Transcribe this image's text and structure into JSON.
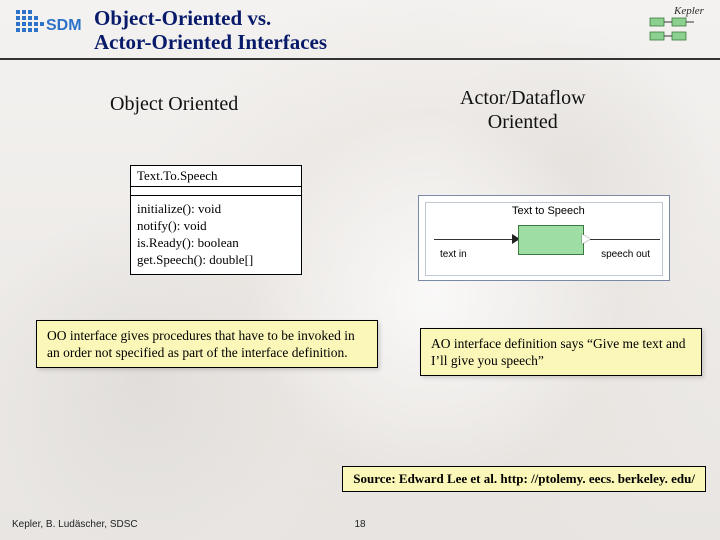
{
  "header": {
    "title_line1": "Object-Oriented vs.",
    "title_line2": "Actor-Oriented Interfaces",
    "logo_left_label": "SDM",
    "logo_right_label": "Kepler"
  },
  "columns": {
    "left_heading": "Object Oriented",
    "right_heading_line1": "Actor/Dataflow",
    "right_heading_line2": "Oriented"
  },
  "uml": {
    "class_name": "Text.To.Speech",
    "methods": [
      "initialize(): void",
      "notify(): void",
      "is.Ready(): boolean",
      "get.Speech(): double[]"
    ]
  },
  "actor": {
    "block_title": "Text to Speech",
    "port_in_label": "text in",
    "port_out_label": "speech out"
  },
  "callouts": {
    "left": "OO interface gives procedures that have to be invoked in an order not specified as part of the interface definition.",
    "right": "AO interface definition says “Give me text and I’ll give you speech”"
  },
  "source": "Source: Edward Lee et al. http: //ptolemy. eecs. berkeley. edu/",
  "footer": {
    "credit": "Kepler, B. Ludäscher, SDSC",
    "page": "18"
  }
}
